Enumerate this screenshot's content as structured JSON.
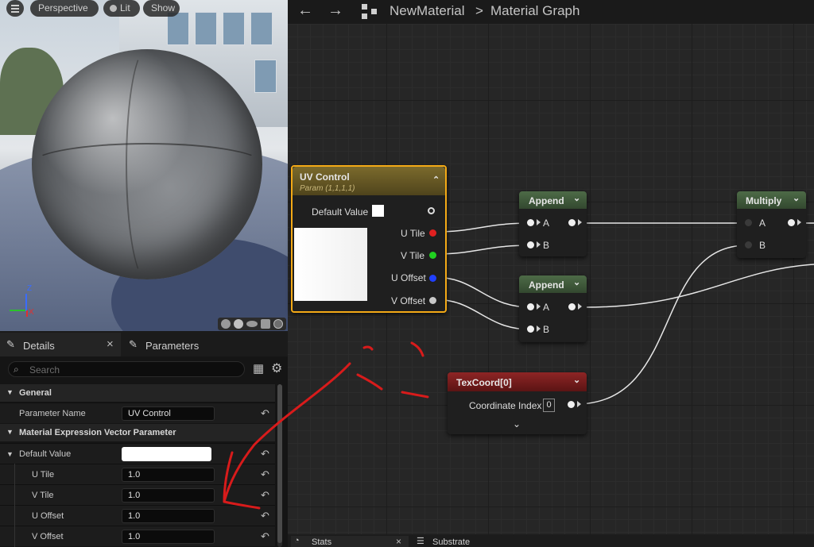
{
  "viewport": {
    "menu_icon": "hamburger-icon",
    "mode_label": "Perspective",
    "lit_label": "Lit",
    "show_label": "Show",
    "axis_z": "Z",
    "axis_x": "X"
  },
  "graph_header": {
    "back_icon": "arrow-left-icon",
    "forward_icon": "arrow-right-icon",
    "graph_icon": "graph-icon",
    "asset_name": "NewMaterial",
    "separator": ">",
    "graph_name": "Material Graph"
  },
  "details": {
    "tabs": [
      {
        "label": "Details",
        "icon": "pencil-icon"
      },
      {
        "label": "Parameters",
        "icon": "pencil-icon"
      }
    ],
    "close_glyph": "×",
    "search_placeholder": "Search",
    "sections": {
      "general": "General",
      "vector_param": "Material Expression Vector Parameter"
    },
    "parameter_name_label": "Parameter Name",
    "parameter_name_value": "UV Control",
    "default_value_label": "Default Value",
    "fields": [
      {
        "label": "U Tile",
        "value": "1.0"
      },
      {
        "label": "V Tile",
        "value": "1.0"
      },
      {
        "label": "U Offset",
        "value": "1.0"
      },
      {
        "label": "V Offset",
        "value": "1.0"
      }
    ]
  },
  "nodes": {
    "uv_control": {
      "title": "UV Control",
      "subtitle": "Param (1,1,1,1)",
      "default_value_label": "Default Value",
      "outputs": [
        "U Tile",
        "V Tile",
        "U Offset",
        "V Offset"
      ],
      "output_colors": [
        "#e02020",
        "#20d020",
        "#2040ff",
        "#c8c8c8"
      ],
      "header_color": "#6b5a22"
    },
    "append1": {
      "title": "Append",
      "inputs": [
        "A",
        "B"
      ],
      "header_color": "#3f5a3a"
    },
    "append2": {
      "title": "Append",
      "inputs": [
        "A",
        "B"
      ],
      "header_color": "#3f5a3a"
    },
    "multiply": {
      "title": "Multiply",
      "inputs": [
        "A",
        "B"
      ],
      "header_color": "#3f5a3a"
    },
    "texcoord": {
      "title": "TexCoord[0]",
      "coord_label": "Coordinate Index",
      "coord_value": "0",
      "header_color": "#7a1a1a"
    }
  },
  "bottom": {
    "stats_label": "Stats",
    "substrate_label": "Substrate"
  }
}
